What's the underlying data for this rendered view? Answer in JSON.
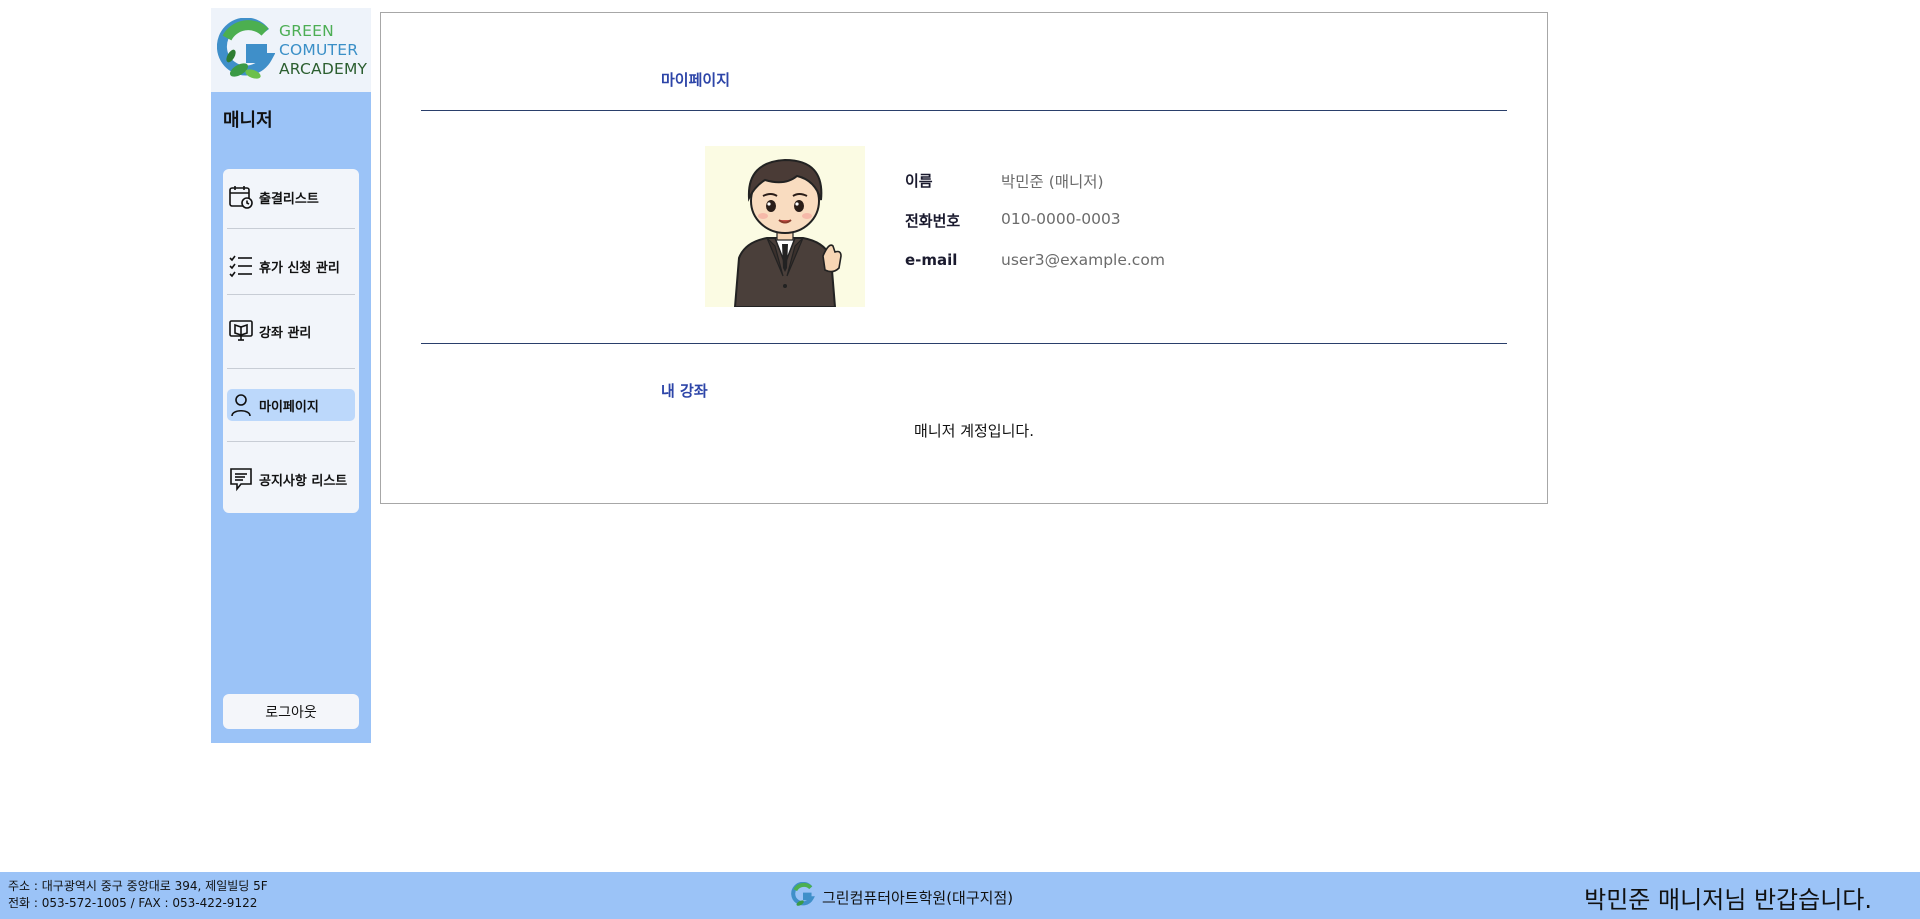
{
  "brand": {
    "logo_lines": [
      "GREEN",
      "COMUTER",
      "ARCADEMY"
    ],
    "colors": {
      "green": "#2e9d3c",
      "blue": "#3f8fc9",
      "dark_green": "#2b5e2f"
    }
  },
  "sidebar": {
    "role_title": "매니저",
    "items": [
      {
        "label": "출결리스트",
        "icon": "calendar-clock-icon"
      },
      {
        "label": "휴가 신청 관리",
        "icon": "checklist-icon"
      },
      {
        "label": "강좌 관리",
        "icon": "book-monitor-icon"
      },
      {
        "label": "마이페이지",
        "icon": "user-icon",
        "active": true
      },
      {
        "label": "공지사항 리스트",
        "icon": "chat-note-icon"
      }
    ],
    "logout_label": "로그아웃"
  },
  "mypage": {
    "title": "마이페이지",
    "profile": {
      "avatar": "manager-cartoon-avatar",
      "name_label": "이름",
      "name_value": "박민준 (매니저)",
      "phone_label": "전화번호",
      "phone_value": "010-0000-0003",
      "email_label": "e-mail",
      "email_value": "user3@example.com"
    },
    "courses_title": "내 강좌",
    "courses_notice": "매니저 계정입니다."
  },
  "footer": {
    "address_line1": "주소 : 대구광역시 중구 중앙대로 394, 제일빌딩 5F",
    "address_line2": "전화 : 053-572-1005 / FAX : 053-422-9122",
    "academy_name": "그린컴퓨터아트학원(대구지점)",
    "welcome": "박민준 매니저님 반갑습니다."
  },
  "colors": {
    "sidebar_bg": "#9bc3f7",
    "section_title": "#2d45a8",
    "active_item": "#bcd8fb"
  }
}
